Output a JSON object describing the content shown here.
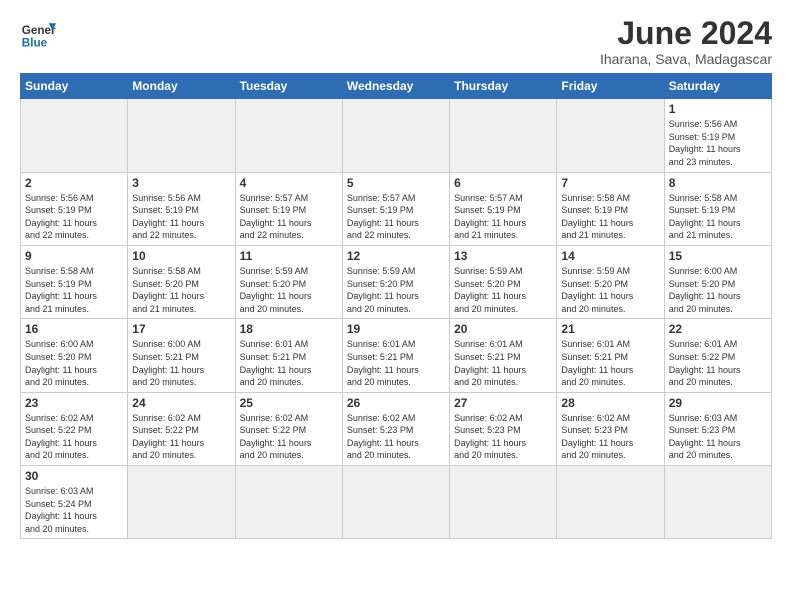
{
  "header": {
    "logo_general": "General",
    "logo_blue": "Blue",
    "month_title": "June 2024",
    "location": "Iharana, Sava, Madagascar"
  },
  "days_of_week": [
    "Sunday",
    "Monday",
    "Tuesday",
    "Wednesday",
    "Thursday",
    "Friday",
    "Saturday"
  ],
  "weeks": [
    [
      {
        "day": "",
        "info": "",
        "empty": true
      },
      {
        "day": "",
        "info": "",
        "empty": true
      },
      {
        "day": "",
        "info": "",
        "empty": true
      },
      {
        "day": "",
        "info": "",
        "empty": true
      },
      {
        "day": "",
        "info": "",
        "empty": true
      },
      {
        "day": "",
        "info": "",
        "empty": true
      },
      {
        "day": "1",
        "info": "Sunrise: 5:56 AM\nSunset: 5:19 PM\nDaylight: 11 hours\nand 23 minutes."
      }
    ],
    [
      {
        "day": "2",
        "info": "Sunrise: 5:56 AM\nSunset: 5:19 PM\nDaylight: 11 hours\nand 22 minutes."
      },
      {
        "day": "3",
        "info": "Sunrise: 5:56 AM\nSunset: 5:19 PM\nDaylight: 11 hours\nand 22 minutes."
      },
      {
        "day": "4",
        "info": "Sunrise: 5:57 AM\nSunset: 5:19 PM\nDaylight: 11 hours\nand 22 minutes."
      },
      {
        "day": "5",
        "info": "Sunrise: 5:57 AM\nSunset: 5:19 PM\nDaylight: 11 hours\nand 22 minutes."
      },
      {
        "day": "6",
        "info": "Sunrise: 5:57 AM\nSunset: 5:19 PM\nDaylight: 11 hours\nand 21 minutes."
      },
      {
        "day": "7",
        "info": "Sunrise: 5:58 AM\nSunset: 5:19 PM\nDaylight: 11 hours\nand 21 minutes."
      },
      {
        "day": "8",
        "info": "Sunrise: 5:58 AM\nSunset: 5:19 PM\nDaylight: 11 hours\nand 21 minutes."
      }
    ],
    [
      {
        "day": "9",
        "info": "Sunrise: 5:58 AM\nSunset: 5:19 PM\nDaylight: 11 hours\nand 21 minutes."
      },
      {
        "day": "10",
        "info": "Sunrise: 5:58 AM\nSunset: 5:20 PM\nDaylight: 11 hours\nand 21 minutes."
      },
      {
        "day": "11",
        "info": "Sunrise: 5:59 AM\nSunset: 5:20 PM\nDaylight: 11 hours\nand 20 minutes."
      },
      {
        "day": "12",
        "info": "Sunrise: 5:59 AM\nSunset: 5:20 PM\nDaylight: 11 hours\nand 20 minutes."
      },
      {
        "day": "13",
        "info": "Sunrise: 5:59 AM\nSunset: 5:20 PM\nDaylight: 11 hours\nand 20 minutes."
      },
      {
        "day": "14",
        "info": "Sunrise: 5:59 AM\nSunset: 5:20 PM\nDaylight: 11 hours\nand 20 minutes."
      },
      {
        "day": "15",
        "info": "Sunrise: 6:00 AM\nSunset: 5:20 PM\nDaylight: 11 hours\nand 20 minutes."
      }
    ],
    [
      {
        "day": "16",
        "info": "Sunrise: 6:00 AM\nSunset: 5:20 PM\nDaylight: 11 hours\nand 20 minutes."
      },
      {
        "day": "17",
        "info": "Sunrise: 6:00 AM\nSunset: 5:21 PM\nDaylight: 11 hours\nand 20 minutes."
      },
      {
        "day": "18",
        "info": "Sunrise: 6:01 AM\nSunset: 5:21 PM\nDaylight: 11 hours\nand 20 minutes."
      },
      {
        "day": "19",
        "info": "Sunrise: 6:01 AM\nSunset: 5:21 PM\nDaylight: 11 hours\nand 20 minutes."
      },
      {
        "day": "20",
        "info": "Sunrise: 6:01 AM\nSunset: 5:21 PM\nDaylight: 11 hours\nand 20 minutes."
      },
      {
        "day": "21",
        "info": "Sunrise: 6:01 AM\nSunset: 5:21 PM\nDaylight: 11 hours\nand 20 minutes."
      },
      {
        "day": "22",
        "info": "Sunrise: 6:01 AM\nSunset: 5:22 PM\nDaylight: 11 hours\nand 20 minutes."
      }
    ],
    [
      {
        "day": "23",
        "info": "Sunrise: 6:02 AM\nSunset: 5:22 PM\nDaylight: 11 hours\nand 20 minutes."
      },
      {
        "day": "24",
        "info": "Sunrise: 6:02 AM\nSunset: 5:22 PM\nDaylight: 11 hours\nand 20 minutes."
      },
      {
        "day": "25",
        "info": "Sunrise: 6:02 AM\nSunset: 5:22 PM\nDaylight: 11 hours\nand 20 minutes."
      },
      {
        "day": "26",
        "info": "Sunrise: 6:02 AM\nSunset: 5:23 PM\nDaylight: 11 hours\nand 20 minutes."
      },
      {
        "day": "27",
        "info": "Sunrise: 6:02 AM\nSunset: 5:23 PM\nDaylight: 11 hours\nand 20 minutes."
      },
      {
        "day": "28",
        "info": "Sunrise: 6:02 AM\nSunset: 5:23 PM\nDaylight: 11 hours\nand 20 minutes."
      },
      {
        "day": "29",
        "info": "Sunrise: 6:03 AM\nSunset: 5:23 PM\nDaylight: 11 hours\nand 20 minutes."
      }
    ],
    [
      {
        "day": "30",
        "info": "Sunrise: 6:03 AM\nSunset: 5:24 PM\nDaylight: 11 hours\nand 20 minutes."
      },
      {
        "day": "",
        "info": "",
        "empty": true
      },
      {
        "day": "",
        "info": "",
        "empty": true
      },
      {
        "day": "",
        "info": "",
        "empty": true
      },
      {
        "day": "",
        "info": "",
        "empty": true
      },
      {
        "day": "",
        "info": "",
        "empty": true
      },
      {
        "day": "",
        "info": "",
        "empty": true
      }
    ]
  ]
}
